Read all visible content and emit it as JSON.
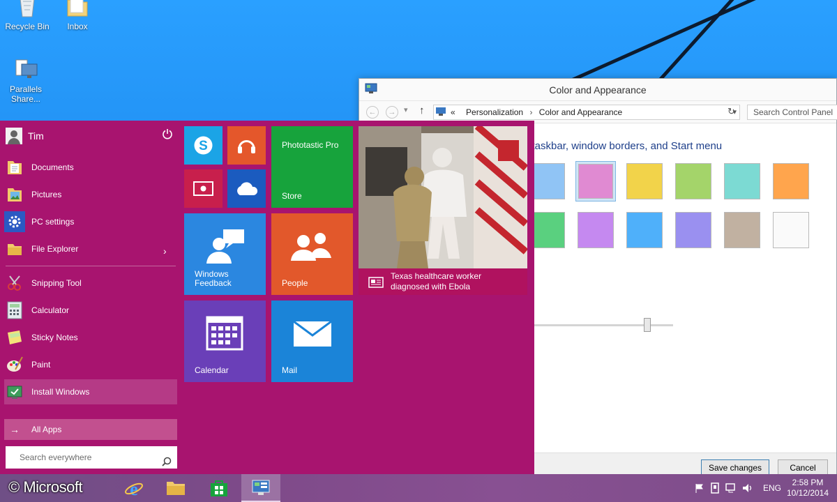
{
  "desktop": {
    "icons": [
      {
        "label": "Recycle Bin"
      },
      {
        "label": "Inbox"
      },
      {
        "label": "Parallels Share..."
      }
    ]
  },
  "window": {
    "title": "Color and Appearance",
    "breadcrumb_root": "«",
    "breadcrumb_1": "Personalization",
    "breadcrumb_2": "Color and Appearance",
    "search_placeholder": "Search Control Panel",
    "heading": "ur taskbar, window borders, and Start menu",
    "swatch_colors": [
      "#90c4f5",
      "#e08ad2",
      "#f2d34a",
      "#a4d46a",
      "#7cdad3",
      "#ffa54d",
      "#5ad07f",
      "#c589f0",
      "#4fb0fa",
      "#9a90f0",
      "#c1b1a1",
      "#fafafa"
    ],
    "selected_swatch": 1,
    "save_label": "Save changes",
    "cancel_label": "Cancel"
  },
  "start": {
    "user": "Tim",
    "items": [
      {
        "label": "Documents",
        "icon": "folder-documents-icon"
      },
      {
        "label": "Pictures",
        "icon": "folder-pictures-icon"
      },
      {
        "label": "PC settings",
        "icon": "gear-icon"
      },
      {
        "label": "File Explorer",
        "icon": "file-explorer-icon"
      },
      {
        "label": "Snipping Tool",
        "icon": "scissors-icon"
      },
      {
        "label": "Calculator",
        "icon": "calculator-icon"
      },
      {
        "label": "Sticky Notes",
        "icon": "sticky-notes-icon"
      },
      {
        "label": "Paint",
        "icon": "paint-palette-icon"
      },
      {
        "label": "Install Windows",
        "icon": "install-windows-icon"
      }
    ],
    "all_apps": "All Apps",
    "search_placeholder": "Search everywhere",
    "tiles": {
      "phototastic": "Phototastic Pro",
      "store": "Store",
      "feedback_1": "Windows",
      "feedback_2": "Feedback",
      "people": "People",
      "calendar": "Calendar",
      "mail": "Mail",
      "news_1": "Texas healthcare worker",
      "news_2": "diagnosed with Ebola"
    },
    "tile_colors": {
      "skype": "#1ba4e6",
      "music": "#e4572b",
      "video": "#c81f4c",
      "onedrive": "#1b5bbf",
      "store": "#17a33c",
      "feedback": "#2b87e0",
      "people": "#e2582b",
      "calendar": "#6a3fb8",
      "mail": "#1b84d8"
    }
  },
  "taskbar": {
    "watermark": "© Microsoft",
    "lang": "ENG",
    "time": "2:58 PM",
    "date": "10/12/2014"
  },
  "accent_color": "#a8146f"
}
